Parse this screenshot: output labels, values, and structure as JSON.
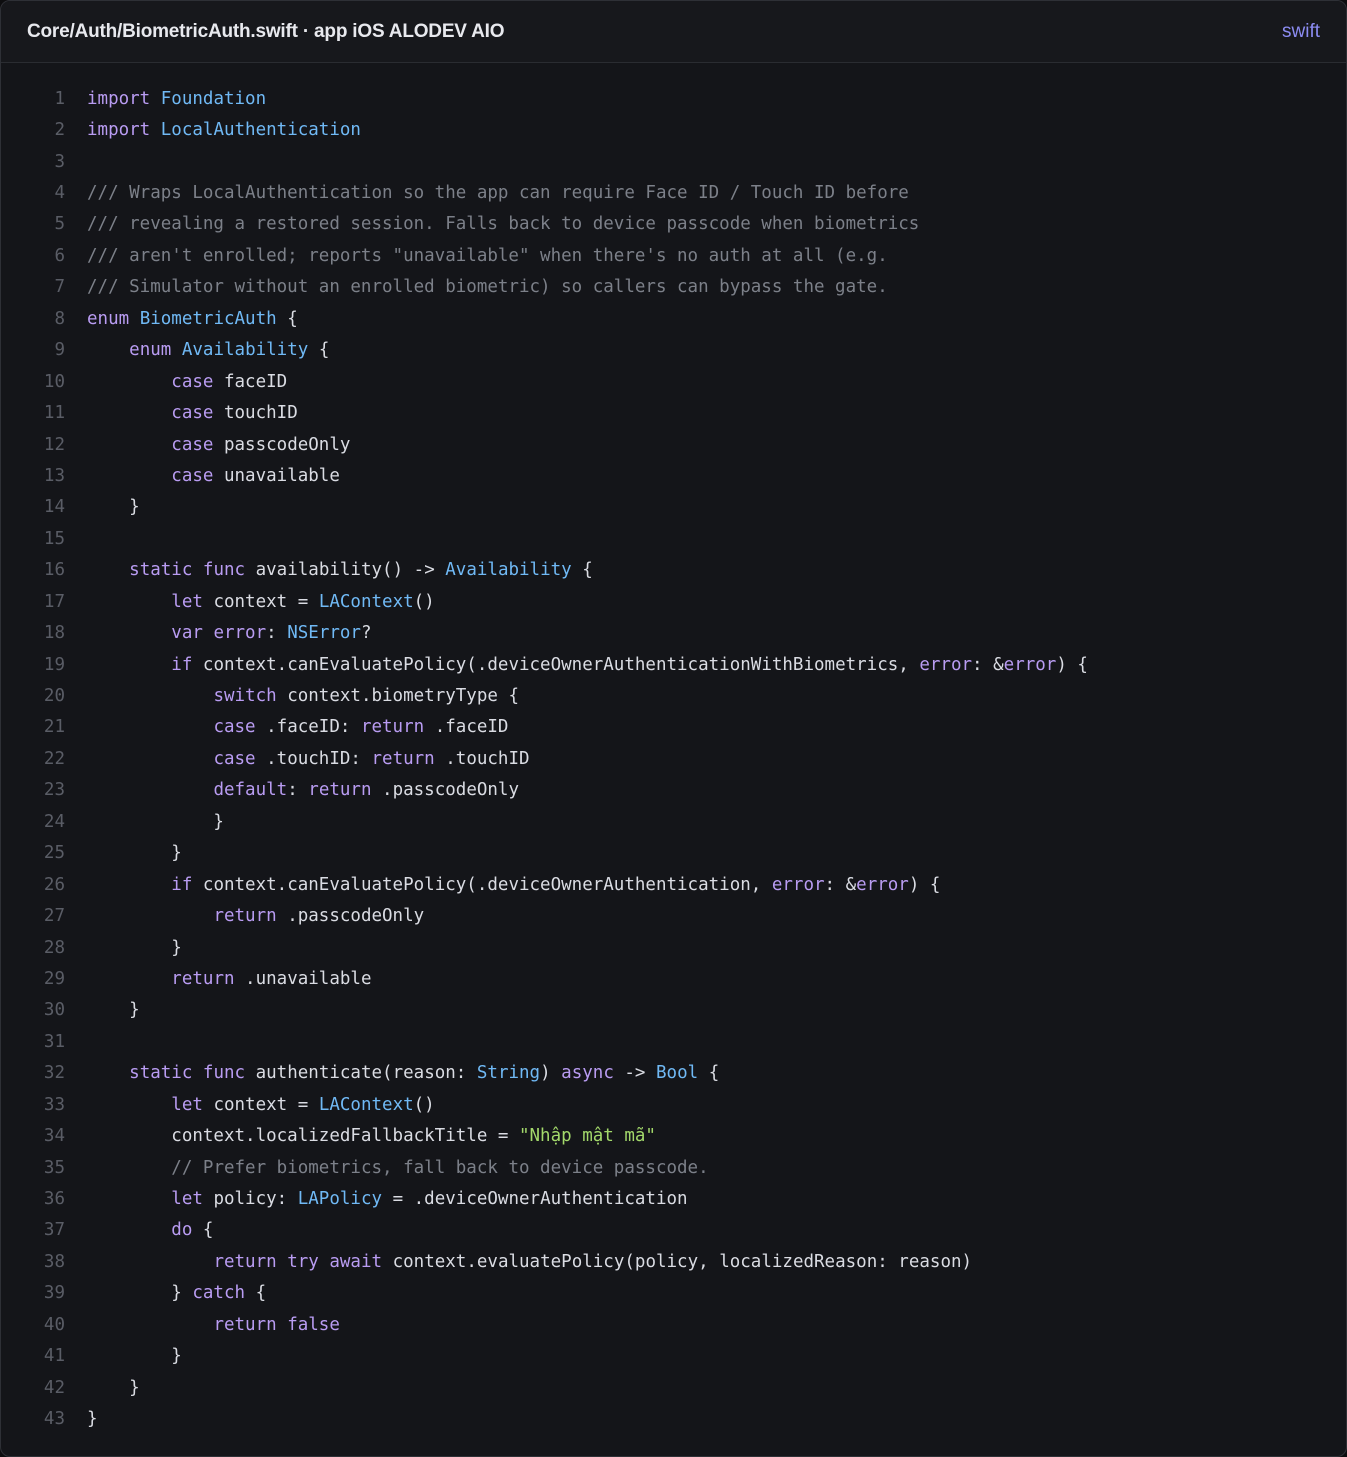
{
  "header": {
    "file_path": "Core/Auth/BiometricAuth.swift · app iOS ALODEV AIO",
    "language": "swift"
  },
  "colors": {
    "keyword": "#b99cf2",
    "type": "#70b9f5",
    "comment": "#7c8089",
    "string": "#a3d96b",
    "plain": "#dadce3",
    "line_number": "#5a5d66",
    "background": "#141519"
  },
  "code_lines": [
    [
      [
        "kw",
        "import"
      ],
      [
        "pl",
        " "
      ],
      [
        "ty",
        "Foundation"
      ]
    ],
    [
      [
        "kw",
        "import"
      ],
      [
        "pl",
        " "
      ],
      [
        "ty",
        "LocalAuthentication"
      ]
    ],
    [],
    [
      [
        "cm",
        "/// Wraps LocalAuthentication so the app can require Face ID / Touch ID before"
      ]
    ],
    [
      [
        "cm",
        "/// revealing a restored session. Falls back to device passcode when biometrics"
      ]
    ],
    [
      [
        "cm",
        "/// aren't enrolled; reports \"unavailable\" when there's no auth at all (e.g."
      ]
    ],
    [
      [
        "cm",
        "/// Simulator without an enrolled biometric) so callers can bypass the gate."
      ]
    ],
    [
      [
        "kw",
        "enum"
      ],
      [
        "pl",
        " "
      ],
      [
        "ty",
        "BiometricAuth"
      ],
      [
        "pl",
        " {"
      ]
    ],
    [
      [
        "pl",
        "    "
      ],
      [
        "kw",
        "enum"
      ],
      [
        "pl",
        " "
      ],
      [
        "ty",
        "Availability"
      ],
      [
        "pl",
        " {"
      ]
    ],
    [
      [
        "pl",
        "        "
      ],
      [
        "kw",
        "case"
      ],
      [
        "pl",
        " faceID"
      ]
    ],
    [
      [
        "pl",
        "        "
      ],
      [
        "kw",
        "case"
      ],
      [
        "pl",
        " touchID"
      ]
    ],
    [
      [
        "pl",
        "        "
      ],
      [
        "kw",
        "case"
      ],
      [
        "pl",
        " passcodeOnly"
      ]
    ],
    [
      [
        "pl",
        "        "
      ],
      [
        "kw",
        "case"
      ],
      [
        "pl",
        " unavailable"
      ]
    ],
    [
      [
        "pl",
        "    }"
      ]
    ],
    [],
    [
      [
        "pl",
        "    "
      ],
      [
        "kw",
        "static"
      ],
      [
        "pl",
        " "
      ],
      [
        "kw",
        "func"
      ],
      [
        "pl",
        " availability() -> "
      ],
      [
        "ty",
        "Availability"
      ],
      [
        "pl",
        " {"
      ]
    ],
    [
      [
        "pl",
        "        "
      ],
      [
        "kw",
        "let"
      ],
      [
        "pl",
        " context = "
      ],
      [
        "ty",
        "LAContext"
      ],
      [
        "pl",
        "()"
      ]
    ],
    [
      [
        "pl",
        "        "
      ],
      [
        "kw",
        "var"
      ],
      [
        "pl",
        " "
      ],
      [
        "kw",
        "error"
      ],
      [
        "pl",
        ": "
      ],
      [
        "ty",
        "NSError"
      ],
      [
        "pl",
        "?"
      ]
    ],
    [
      [
        "pl",
        "        "
      ],
      [
        "kw",
        "if"
      ],
      [
        "pl",
        " context.canEvaluatePolicy(.deviceOwnerAuthenticationWithBiometrics, "
      ],
      [
        "kw",
        "error"
      ],
      [
        "pl",
        ": &"
      ],
      [
        "kw",
        "error"
      ],
      [
        "pl",
        ") {"
      ]
    ],
    [
      [
        "pl",
        "            "
      ],
      [
        "kw",
        "switch"
      ],
      [
        "pl",
        " context.biometryType {"
      ]
    ],
    [
      [
        "pl",
        "            "
      ],
      [
        "kw",
        "case"
      ],
      [
        "pl",
        " .faceID: "
      ],
      [
        "kw",
        "return"
      ],
      [
        "pl",
        " .faceID"
      ]
    ],
    [
      [
        "pl",
        "            "
      ],
      [
        "kw",
        "case"
      ],
      [
        "pl",
        " .touchID: "
      ],
      [
        "kw",
        "return"
      ],
      [
        "pl",
        " .touchID"
      ]
    ],
    [
      [
        "pl",
        "            "
      ],
      [
        "kw",
        "default"
      ],
      [
        "pl",
        ": "
      ],
      [
        "kw",
        "return"
      ],
      [
        "pl",
        " .passcodeOnly"
      ]
    ],
    [
      [
        "pl",
        "            }"
      ]
    ],
    [
      [
        "pl",
        "        }"
      ]
    ],
    [
      [
        "pl",
        "        "
      ],
      [
        "kw",
        "if"
      ],
      [
        "pl",
        " context.canEvaluatePolicy(.deviceOwnerAuthentication, "
      ],
      [
        "kw",
        "error"
      ],
      [
        "pl",
        ": &"
      ],
      [
        "kw",
        "error"
      ],
      [
        "pl",
        ") {"
      ]
    ],
    [
      [
        "pl",
        "            "
      ],
      [
        "kw",
        "return"
      ],
      [
        "pl",
        " .passcodeOnly"
      ]
    ],
    [
      [
        "pl",
        "        }"
      ]
    ],
    [
      [
        "pl",
        "        "
      ],
      [
        "kw",
        "return"
      ],
      [
        "pl",
        " .unavailable"
      ]
    ],
    [
      [
        "pl",
        "    }"
      ]
    ],
    [],
    [
      [
        "pl",
        "    "
      ],
      [
        "kw",
        "static"
      ],
      [
        "pl",
        " "
      ],
      [
        "kw",
        "func"
      ],
      [
        "pl",
        " authenticate(reason: "
      ],
      [
        "ty",
        "String"
      ],
      [
        "pl",
        ") "
      ],
      [
        "kw",
        "async"
      ],
      [
        "pl",
        " -> "
      ],
      [
        "ty",
        "Bool"
      ],
      [
        "pl",
        " {"
      ]
    ],
    [
      [
        "pl",
        "        "
      ],
      [
        "kw",
        "let"
      ],
      [
        "pl",
        " context = "
      ],
      [
        "ty",
        "LAContext"
      ],
      [
        "pl",
        "()"
      ]
    ],
    [
      [
        "pl",
        "        context.localizedFallbackTitle = "
      ],
      [
        "st",
        "\"Nhập mật mã\""
      ]
    ],
    [
      [
        "pl",
        "        "
      ],
      [
        "cm",
        "// Prefer biometrics, fall back to device passcode."
      ]
    ],
    [
      [
        "pl",
        "        "
      ],
      [
        "kw",
        "let"
      ],
      [
        "pl",
        " policy: "
      ],
      [
        "ty",
        "LAPolicy"
      ],
      [
        "pl",
        " = .deviceOwnerAuthentication"
      ]
    ],
    [
      [
        "pl",
        "        "
      ],
      [
        "kw",
        "do"
      ],
      [
        "pl",
        " {"
      ]
    ],
    [
      [
        "pl",
        "            "
      ],
      [
        "kw",
        "return"
      ],
      [
        "pl",
        " "
      ],
      [
        "kw",
        "try"
      ],
      [
        "pl",
        " "
      ],
      [
        "kw",
        "await"
      ],
      [
        "pl",
        " context.evaluatePolicy(policy, localizedReason: reason)"
      ]
    ],
    [
      [
        "pl",
        "        } "
      ],
      [
        "kw",
        "catch"
      ],
      [
        "pl",
        " {"
      ]
    ],
    [
      [
        "pl",
        "            "
      ],
      [
        "kw",
        "return"
      ],
      [
        "pl",
        " "
      ],
      [
        "kw",
        "false"
      ]
    ],
    [
      [
        "pl",
        "        }"
      ]
    ],
    [
      [
        "pl",
        "    }"
      ]
    ],
    [
      [
        "pl",
        "}"
      ]
    ]
  ]
}
